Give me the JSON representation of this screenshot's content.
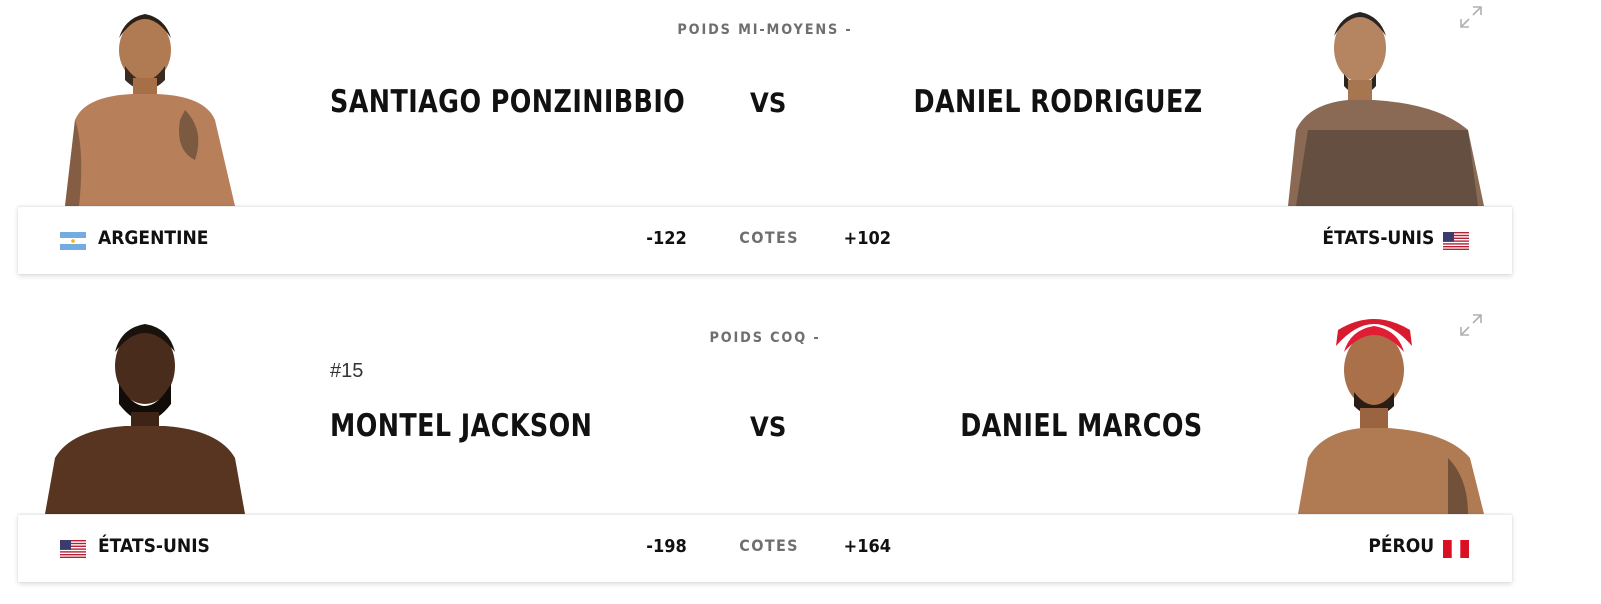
{
  "fights": [
    {
      "weight_class": "POIDS MI-MOYENS -",
      "rank": "",
      "red": {
        "name": "SANTIAGO PONZINIBBIO",
        "country": "ARGENTINE",
        "flag": "argentina-flag",
        "odds": "-122"
      },
      "blue": {
        "name": "DANIEL RODRIGUEZ",
        "country": "ÉTATS-UNIS",
        "flag": "usa-flag",
        "odds": "+102"
      },
      "vs_label": "VS",
      "odds_label": "COTES"
    },
    {
      "weight_class": "POIDS COQ -",
      "rank": "#15",
      "red": {
        "name": "MONTEL JACKSON",
        "country": "ÉTATS-UNIS",
        "flag": "usa-flag",
        "odds": "-198"
      },
      "blue": {
        "name": "DANIEL MARCOS",
        "country": "PÉROU",
        "flag": "peru-flag",
        "odds": "+164"
      },
      "vs_label": "VS",
      "odds_label": "COTES"
    }
  ],
  "colors": {
    "text": "#111111",
    "muted": "#6f6f6f",
    "argentina_blue": "#74acdf",
    "usa_red": "#b22234",
    "usa_blue": "#3c3b6e",
    "peru_red": "#d91023"
  },
  "icons": [
    "expand-icon"
  ]
}
